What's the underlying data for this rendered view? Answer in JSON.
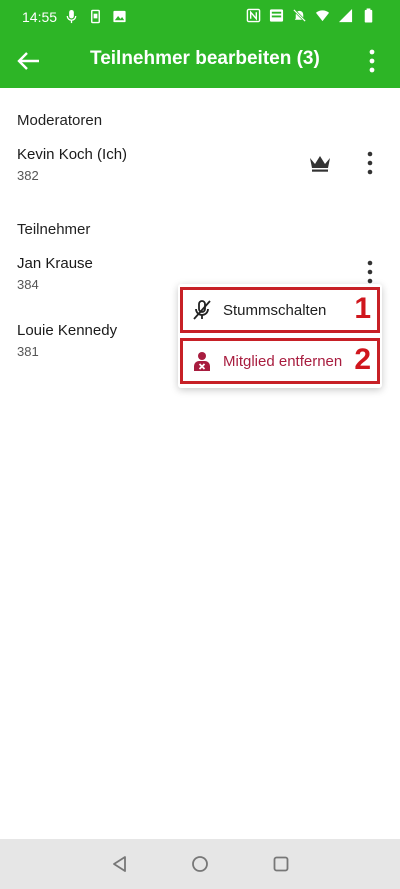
{
  "status_bar": {
    "time": "14:55",
    "left_icons": [
      "microphone-icon",
      "sim-icon",
      "image-icon"
    ],
    "right_icons": [
      "nfc-icon",
      "volte-icon",
      "mute-icon",
      "wifi-icon",
      "signal-icon",
      "battery-icon"
    ]
  },
  "app_bar": {
    "title": "Teilnehmer bearbeiten (3)",
    "back_icon": "arrow-left-icon",
    "more_icon": "more-vert-icon"
  },
  "moderators": {
    "header": "Moderatoren",
    "items": [
      {
        "name": "Kevin Koch (Ich)",
        "number": "382",
        "role_icon": "crown-icon"
      }
    ]
  },
  "participants": {
    "header": "Teilnehmer",
    "items": [
      {
        "name": "Jan Krause",
        "number": "384"
      },
      {
        "name": "Louie Kennedy",
        "number": "381"
      }
    ]
  },
  "popup_menu": {
    "items": [
      {
        "label": "Stummschalten",
        "icon": "mic-off-icon",
        "annotation": "1"
      },
      {
        "label": "Mitglied entfernen",
        "icon": "remove-member-icon",
        "annotation": "2"
      }
    ]
  },
  "colors": {
    "primary": "#2db526",
    "danger": "#a81d3f",
    "annotation": "#d0161d",
    "nav_bar": "#e6e6e6"
  }
}
